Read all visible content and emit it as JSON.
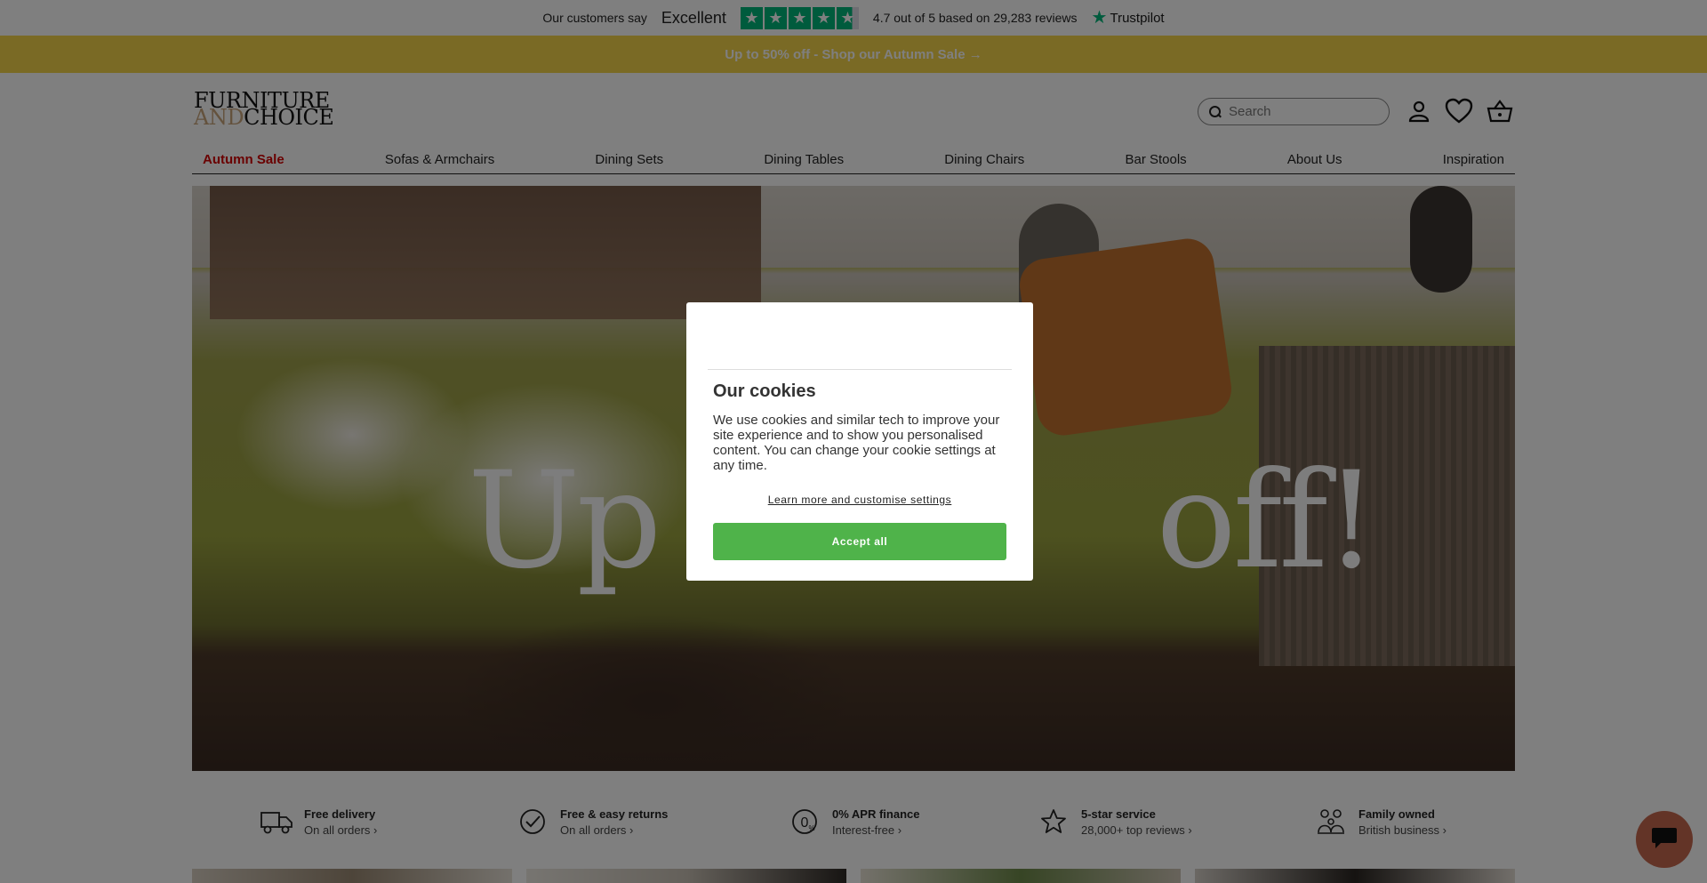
{
  "trustpilot": {
    "customers_say": "Our customers say",
    "rating_word": "Excellent",
    "stars": 4.7,
    "score_text": "4.7 out of 5 based on 29,283 reviews",
    "brand": "Trustpilot",
    "brand_color": "#00b67a"
  },
  "promo": {
    "text": "Up to 50% off - Shop our Autumn Sale →",
    "background": "#f5d44a"
  },
  "header": {
    "logo_line1": "FURNITURE",
    "logo_and": "AND",
    "logo_choice": "CHOICE",
    "search_placeholder": "Search",
    "icons": [
      "account-icon",
      "wishlist-heart-icon",
      "basket-icon"
    ]
  },
  "nav": {
    "items": [
      "Autumn Sale",
      "Sofas & Armchairs",
      "Dining Sets",
      "Dining Tables",
      "Dining Chairs",
      "Bar Stools",
      "About Us",
      "Inspiration"
    ],
    "sale_color": "#d40000"
  },
  "hero": {
    "headline_part1": "Up t",
    "headline_part2": "off!"
  },
  "features": [
    {
      "icon": "delivery-truck-icon",
      "title": "Free delivery",
      "sub": "On all orders"
    },
    {
      "icon": "check-circle-icon",
      "title": "Free & easy returns",
      "sub": "On all orders"
    },
    {
      "icon": "zero-percent-icon",
      "title": "0% APR finance",
      "sub": "Interest-free"
    },
    {
      "icon": "star-icon",
      "title": "5-star service",
      "sub": "28,000+ top reviews"
    },
    {
      "icon": "family-icon",
      "title": "Family owned",
      "sub": "British business"
    }
  ],
  "cookie_modal": {
    "title": "Our cookies",
    "body": "We use cookies and similar tech to improve your site experience and to show you personalised content. You can change your cookie settings at any time.",
    "learn_more": "Learn more and customise settings",
    "accept": "Accept all",
    "accept_color": "#4fb34a"
  },
  "chat": {
    "icon": "chat-bubble-icon",
    "color": "#c7684f"
  }
}
